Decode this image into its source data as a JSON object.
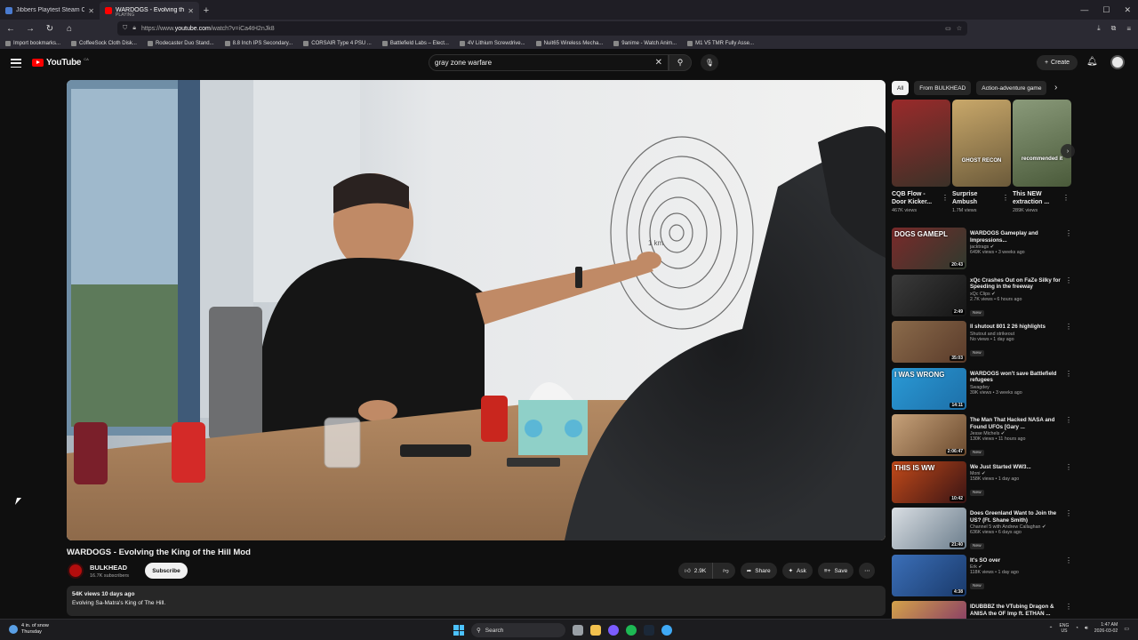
{
  "browser": {
    "tabs": [
      {
        "title": "Jibbers Playtest Steam Charts (A...",
        "subtitle": "",
        "active": false,
        "color": "#4a7bd0"
      },
      {
        "title": "WARDOGS - Evolving the King",
        "subtitle": "PLAYING",
        "active": true,
        "color": "#ff0000"
      }
    ],
    "url_prefix": "https://www.",
    "url_host": "youtube.com",
    "url_path": "/watch?v=iCa4tH2nJk8",
    "bookmarks": [
      "Import bookmarks...",
      "CoffeeSock Cloth Disk...",
      "Rodecaster Duo Stand...",
      "8.8 Inch IPS Secondary...",
      "CORSAIR Type 4 PSU ...",
      "Battlefield Labs – Elect...",
      "4V Lithium Screwdrive...",
      "Nuit65 Wireless Mecha...",
      "9anime - Watch Anim...",
      "M1 V5 TMR Fully Asse..."
    ]
  },
  "header": {
    "logo_text": "YouTube",
    "country": "CA",
    "search_value": "gray zone warfare",
    "create_label": "Create"
  },
  "video": {
    "title": "WARDOGS - Evolving the King of the Hill Mod",
    "channel": "BULKHEAD",
    "subscribers": "16.7K subscribers",
    "subscribe_label": "Subscribe",
    "likes": "2.9K",
    "share_label": "Share",
    "ask_label": "Ask",
    "save_label": "Save",
    "views_date": "54K views  10 days ago",
    "description": "Evolving Sa-Matra's King of The Hill.",
    "whiteboard_label": "1 km"
  },
  "chips": [
    "All",
    "From BULKHEAD",
    "Action-adventure game"
  ],
  "shorts": [
    {
      "title": "CQB Flow - Door Kicker...",
      "views": "467K views",
      "overlay": ""
    },
    {
      "title": "Surprise Ambush",
      "views": "1.7M views",
      "overlay": "GHOST RECON"
    },
    {
      "title": "This NEW extraction ...",
      "views": "289K views",
      "overlay": "recommended it"
    }
  ],
  "recommendations": [
    {
      "title": "WARDOGS Gameplay and Impressions...",
      "channel": "jacktrags",
      "verified": true,
      "meta": "649K views • 3 weeks ago",
      "badge": "",
      "duration": "20:43",
      "bg1": "#2f3a2e",
      "bg2": "#7a2a2a",
      "overlay": "DOGS GAMEPL"
    },
    {
      "title": "xQc Crashes Out on FaZe Silky for Speeding in the freeway",
      "channel": "xQc Clips",
      "verified": true,
      "meta": "2.7K views • 6 hours ago",
      "badge": "New",
      "duration": "2:49",
      "bg1": "#151515",
      "bg2": "#3b3b3b",
      "overlay": ""
    },
    {
      "title": "ll shutout 801 2 26  highlights",
      "channel": "Shutout and strikeout",
      "verified": false,
      "meta": "No views • 1 day ago",
      "badge": "New",
      "duration": "35:03",
      "bg1": "#5a3b2a",
      "bg2": "#8b6b4b",
      "overlay": ""
    },
    {
      "title": "WARDOGS won't save Battlefield refugees",
      "channel": "Swagdey",
      "verified": false,
      "meta": "39K views • 3 weeks ago",
      "badge": "",
      "duration": "14:11",
      "bg1": "#1d6fa8",
      "bg2": "#2a9ad6",
      "overlay": "I WAS WRONG"
    },
    {
      "title": "The Man That Hacked NASA and Found UFOs [Gary ...",
      "channel": "Jesse Michels",
      "verified": true,
      "meta": "130K views • 11 hours ago",
      "badge": "New",
      "duration": "2:06:47",
      "bg1": "#6b4a2e",
      "bg2": "#c7a27a",
      "overlay": ""
    },
    {
      "title": "We Just Started WW3...",
      "channel": "Moni",
      "verified": true,
      "meta": "158K views • 1 day ago",
      "badge": "New",
      "duration": "10:42",
      "bg1": "#3a1414",
      "bg2": "#c24a1a",
      "overlay": "THIS IS WW"
    },
    {
      "title": "Does Greenland Want to Join the US? (Ft. Shane Smith)",
      "channel": "Channel 5 with Andrew Callaghan",
      "verified": true,
      "meta": "636K views • 6 days ago",
      "badge": "New",
      "duration": "21:40",
      "bg1": "#6b7d8c",
      "bg2": "#d9dee3",
      "overlay": ""
    },
    {
      "title": "It's SO over",
      "channel": "Erk",
      "verified": true,
      "meta": "118K views • 1 day ago",
      "badge": "New",
      "duration": "4:38",
      "bg1": "#1a3a6b",
      "bg2": "#3b6fb8",
      "overlay": ""
    },
    {
      "title": "IDUBBBZ the VTubing Dragon & ANISA the OF Imp ft. ETHAN ...",
      "channel": "",
      "verified": false,
      "meta": "",
      "badge": "",
      "duration": "",
      "bg1": "#7a2a6b",
      "bg2": "#d4a24a",
      "overlay": ""
    }
  ],
  "taskbar": {
    "weather_temp": "4 in. of snow",
    "weather_day": "Thursday",
    "search_label": "Search",
    "lang1": "ENG",
    "lang2": "US",
    "time": "1:47 AM",
    "date": "2026-03-02"
  }
}
